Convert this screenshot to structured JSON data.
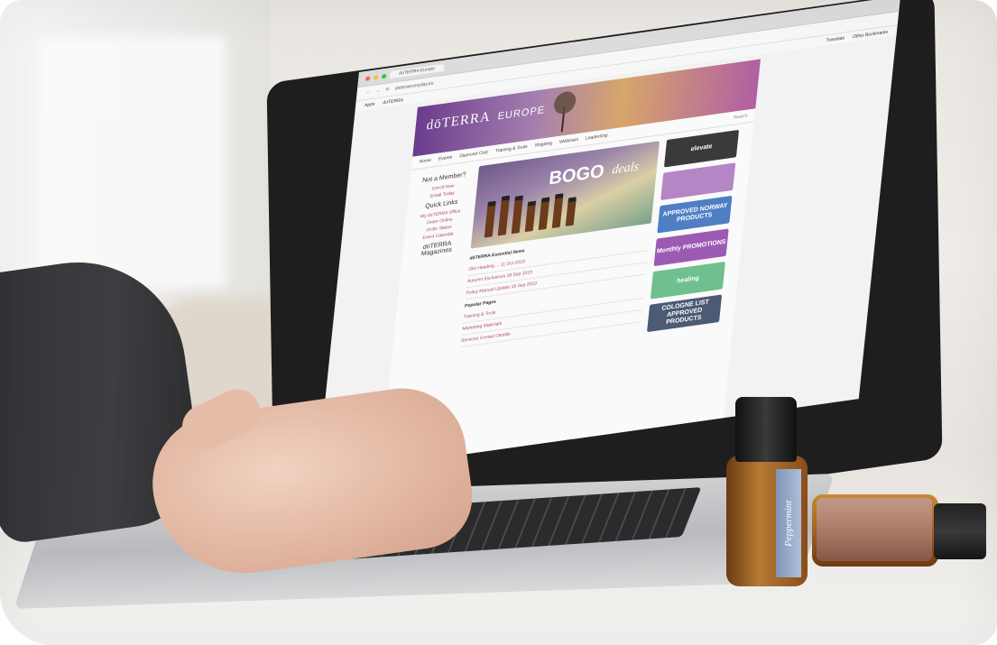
{
  "browser": {
    "tab_title": "doTERRA Europe",
    "url": "doterraeveryday.eu",
    "bookmarks": [
      "Apps",
      "doTERRA",
      "Other Bookmarks",
      "Translate"
    ]
  },
  "site": {
    "logo": "dōTERRA",
    "logo_region": "EUROPE",
    "nav": [
      "Home",
      "Events",
      "Diamond Club",
      "Training & Tools",
      "Shipping",
      "Webinars",
      "Leadership"
    ],
    "search": "Search",
    "left": {
      "not_member": "Not a Member?",
      "links_a": [
        "Enroll Now",
        "Email Today"
      ],
      "quick_links_title": "Quick Links",
      "quick_links": [
        "My doTERRA Office",
        "Order Online",
        "Order Status",
        "Event Calendar"
      ],
      "magazine": "doTERRA Magazines"
    },
    "promo": {
      "title": "BOGO",
      "title_script": "deals"
    },
    "news": {
      "title": "dōTERRA Essential News",
      "items": [
        "Oils Heading ... 11 Oct 2019",
        "Autumn Exclusives 18 Sep 2019",
        "Policy Manual Update 18 Sep 2019"
      ],
      "popular_title": "Popular Pages",
      "popular": [
        "Training & Tools",
        "Marketing Materials",
        "Services Contact Details"
      ]
    },
    "tiles": [
      {
        "label": "elevate",
        "color": "#3a3a3a"
      },
      {
        "label": "",
        "color": "#b486c5"
      },
      {
        "label": "APPROVED NORWAY PRODUCTS",
        "color": "#4e7fc4"
      },
      {
        "label": "Monthly PROMOTIONS",
        "color": "#9c5bb3"
      },
      {
        "label": "healing",
        "color": "#6fbf8f"
      },
      {
        "label": "COLOGNE LIST APPROVED PRODUCTS",
        "color": "#4c5a74"
      }
    ]
  },
  "bottle_label": "Peppermint"
}
